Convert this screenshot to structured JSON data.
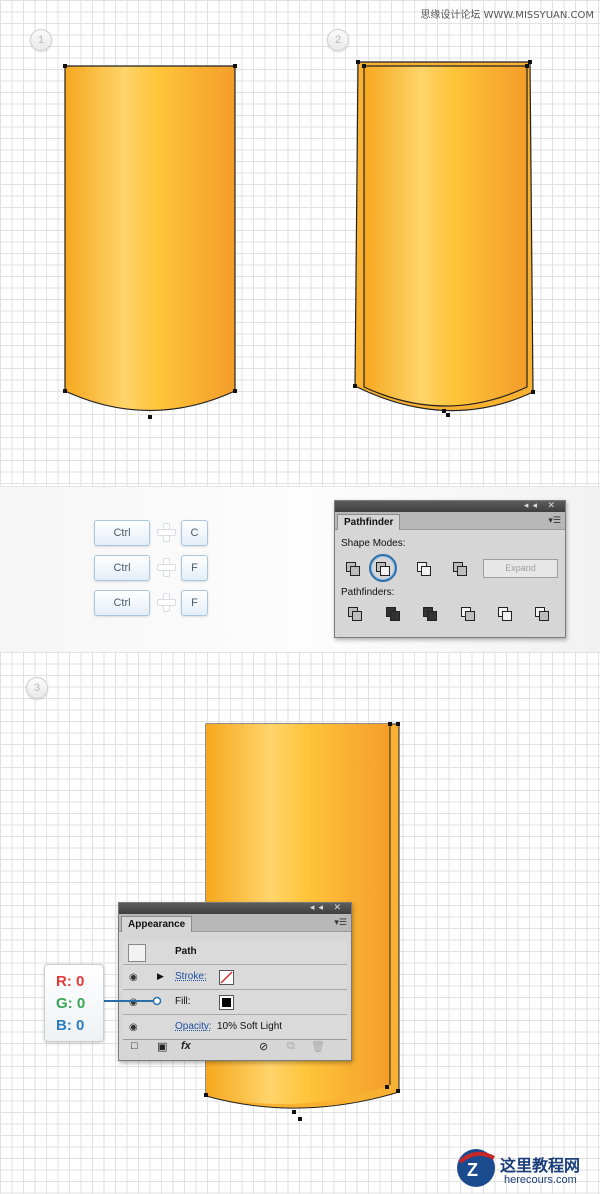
{
  "watermark_top": "思缘设计论坛 WWW.MISSYUAN.COM",
  "steps": [
    "1",
    "2",
    "3"
  ],
  "keys": {
    "ctrl": "Ctrl",
    "c": "C",
    "f1": "F",
    "f2": "F"
  },
  "pathfinder": {
    "tab": "Pathfinder",
    "shape_modes_label": "Shape Modes:",
    "expand_label": "Expand",
    "pathfinders_label": "Pathfinders:"
  },
  "appearance": {
    "tab": "Appearance",
    "path_label": "Path",
    "stroke_label": "Stroke:",
    "fill_label": "Fill:",
    "opacity_label": "Opacity:",
    "opacity_value": "10% Soft Light",
    "fx_label": "fx"
  },
  "rgb": {
    "r": "R: 0",
    "g": "G: 0",
    "b": "B: 0",
    "r_color": "#e03a3a",
    "g_color": "#3aa655",
    "b_color": "#2b7fc0"
  },
  "cylinder_colors": [
    "#f5a623",
    "#ffd466",
    "#f2a13a"
  ],
  "logo": {
    "title": "这里教程网",
    "url": "herecours.com"
  }
}
